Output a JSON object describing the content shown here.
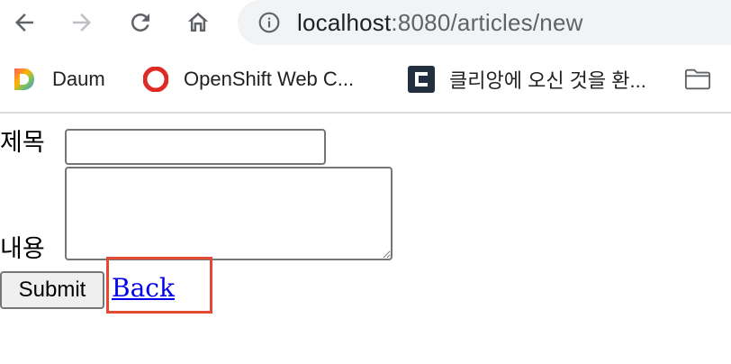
{
  "browser": {
    "url_host": "localhost",
    "url_path": ":8080/articles/new",
    "icons": {
      "back": "arrow-left-icon",
      "forward": "arrow-right-icon",
      "reload": "reload-icon",
      "home": "home-icon",
      "site_info": "info-icon"
    }
  },
  "bookmarks": [
    {
      "label": "Daum",
      "icon": "daum-favicon"
    },
    {
      "label": "OpenShift Web C...",
      "icon": "openshift-favicon"
    },
    {
      "label": "클리앙에 오신 것을 환...",
      "icon": "clien-favicon"
    },
    {
      "label": "",
      "icon": "folder-icon"
    }
  ],
  "form": {
    "title_label": "제목",
    "title_value": "",
    "content_label": "내용",
    "content_value": "",
    "submit_label": "Submit",
    "back_link": "Back"
  },
  "colors": {
    "highlight": "#e24a33",
    "link": "#0000ee",
    "omnibox_bg": "#f1f3f4"
  }
}
